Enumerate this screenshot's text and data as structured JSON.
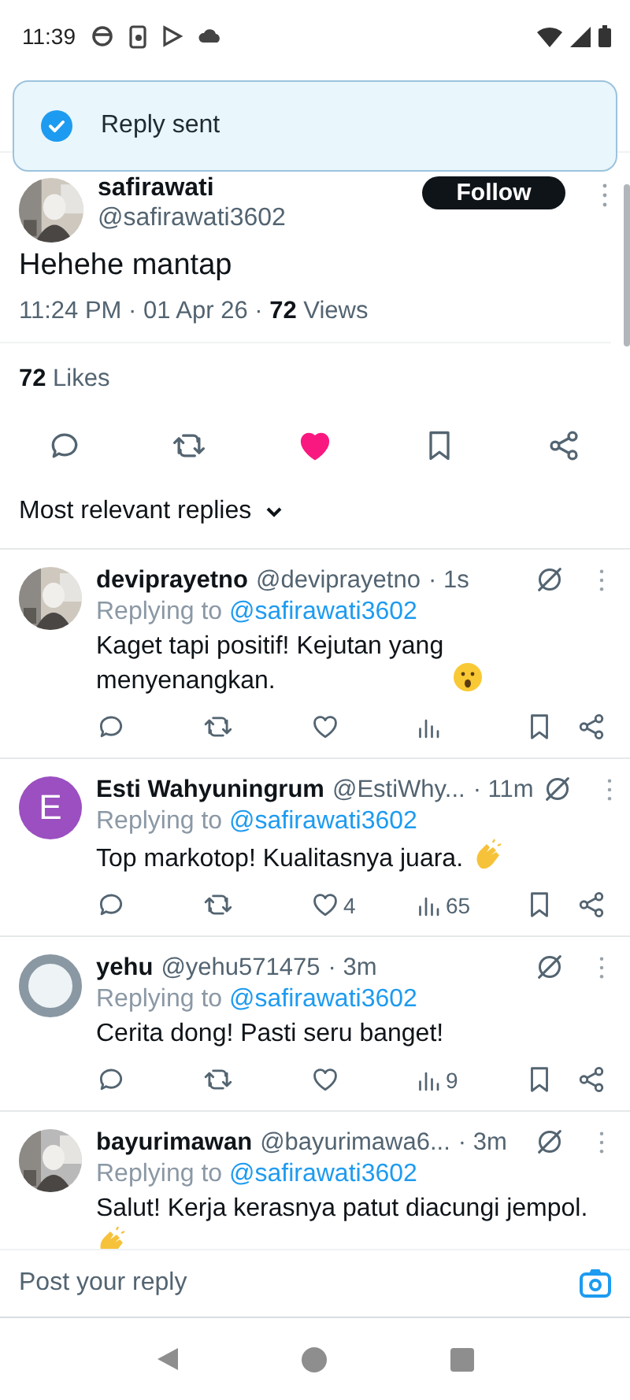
{
  "status_bar": {
    "time": "11:39"
  },
  "toast": {
    "message": "Reply sent"
  },
  "post": {
    "author_name": "safirawati",
    "handle": "@safirawati3602",
    "follow_label": "Follow",
    "text": "Hehehe mantap",
    "timestamp": "11:24 PM · 01 Apr 26 · ",
    "views_count": "72",
    "views_label": " Views",
    "likes_count": "72",
    "likes_label": " Likes",
    "liked": true
  },
  "replies_sort": {
    "label": "Most relevant replies"
  },
  "replies": [
    {
      "name": "deviprayetno",
      "handle": "@deviprayetno",
      "time": "· 1s",
      "replying_label": "Replying to ",
      "replying_handle": "@safirawati3602",
      "text": "Kaget tapi positif! Kejutan yang menyenangkan.",
      "emoji": {
        "kind": "surprised"
      },
      "liked": false
    },
    {
      "avatar": {
        "kind": "letter",
        "letter": "E"
      },
      "name": "Esti Wahyuningrum",
      "handle": "@EstiWhy...",
      "time": "· 11m",
      "replying_label": "Replying to ",
      "replying_handle": "@safirawati3602",
      "text": "Top markotop! Kualitasnya juara.",
      "emoji": {
        "kind": "clap"
      },
      "liked": false,
      "like_count": "4",
      "views_count": "65"
    },
    {
      "avatar": {
        "kind": "default"
      },
      "name": "yehu",
      "handle": "@yehu571475",
      "time": "· 3m",
      "replying_label": "Replying to ",
      "replying_handle": "@safirawati3602",
      "text": "Cerita dong! Pasti seru banget!",
      "liked": false,
      "views_count": "9"
    },
    {
      "name": "bayurimawan",
      "handle": "@bayurimawa6...",
      "time": "· 3m",
      "replying_label": "Replying to ",
      "replying_handle": "@safirawati3602",
      "text": "Salut! Kerja kerasnya patut diacungi jempol.",
      "emoji": {
        "kind": "clap"
      }
    }
  ],
  "reply_bar": {
    "placeholder": "Post your reply"
  }
}
